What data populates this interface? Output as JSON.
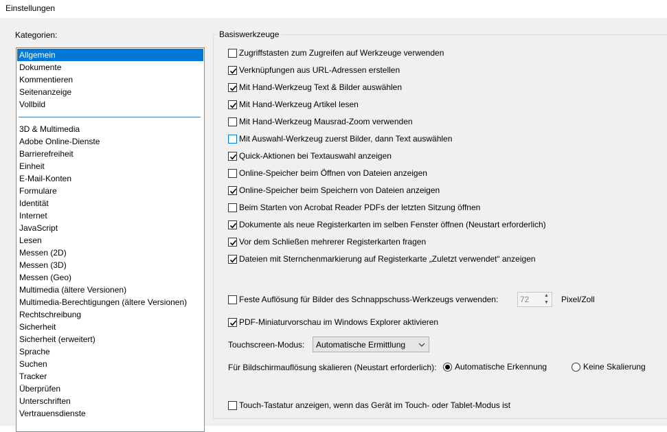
{
  "window": {
    "title": "Einstellungen"
  },
  "categories": {
    "label": "Kategorien:",
    "selected": "Allgemein",
    "group1": [
      "Allgemein",
      "Dokumente",
      "Kommentieren",
      "Seitenanzeige",
      "Vollbild"
    ],
    "group2": [
      "3D & Multimedia",
      "Adobe Online-Dienste",
      "Barrierefreiheit",
      "Einheit",
      "E-Mail-Konten",
      "Formulare",
      "Identität",
      "Internet",
      "JavaScript",
      "Lesen",
      "Messen (2D)",
      "Messen (3D)",
      "Messen (Geo)",
      "Multimedia (ältere Versionen)",
      "Multimedia-Berechtigungen (ältere Versionen)",
      "Rechtschreibung",
      "Sicherheit",
      "Sicherheit (erweitert)",
      "Sprache",
      "Suchen",
      "Tracker",
      "Überprüfen",
      "Unterschriften",
      "Vertrauensdienste"
    ]
  },
  "basis": {
    "title": "Basiswerkzeuge",
    "options": [
      {
        "label": "Zugriffstasten zum Zugreifen auf Werkzeuge verwenden",
        "checked": false
      },
      {
        "label": "Verknüpfungen aus URL-Adressen erstellen",
        "checked": true
      },
      {
        "label": "Mit Hand-Werkzeug Text & Bilder auswählen",
        "checked": true
      },
      {
        "label": "Mit Hand-Werkzeug Artikel lesen",
        "checked": true
      },
      {
        "label": "Mit Hand-Werkzeug Mausrad-Zoom verwenden",
        "checked": false
      },
      {
        "label": "Mit Auswahl-Werkzeug zuerst Bilder, dann Text auswählen",
        "checked": false
      },
      {
        "label": "Quick-Aktionen bei Textauswahl anzeigen",
        "checked": true
      },
      {
        "label": "Online-Speicher beim Öffnen von Dateien anzeigen",
        "checked": false
      },
      {
        "label": "Online-Speicher beim Speichern von Dateien anzeigen",
        "checked": true
      },
      {
        "label": "Beim Starten von Acrobat Reader PDFs der letzten Sitzung öffnen",
        "checked": false
      },
      {
        "label": "Dokumente als neue Registerkarten im selben Fenster öffnen (Neustart erforderlich)",
        "checked": true
      },
      {
        "label": "Vor dem Schließen mehrerer Registerkarten fragen",
        "checked": true
      },
      {
        "label": "Dateien mit Sternchenmarkierung auf Registerkarte „Zuletzt verwendet“ anzeigen",
        "checked": true
      }
    ],
    "snapshot": {
      "label": "Feste Auflösung für Bilder des Schnappschuss-Werkzeugs verwenden:",
      "checked": false,
      "value": "72",
      "unit": "Pixel/Zoll"
    },
    "thumbnail": {
      "label": "PDF-Miniaturvorschau im Windows Explorer aktivieren",
      "checked": true
    },
    "touchscreen": {
      "label": "Touchscreen-Modus:",
      "value": "Automatische Ermittlung"
    },
    "scaling": {
      "label": "Für Bildschirmauflösung skalieren (Neustart erforderlich):",
      "option_auto": "Automatische Erkennung",
      "option_none": "Keine Skalierung",
      "selected": "auto"
    },
    "touch_keyboard": {
      "label": "Touch-Tastatur anzeigen, wenn das Gerät im Touch- oder Tablet-Modus ist",
      "checked": false
    }
  }
}
